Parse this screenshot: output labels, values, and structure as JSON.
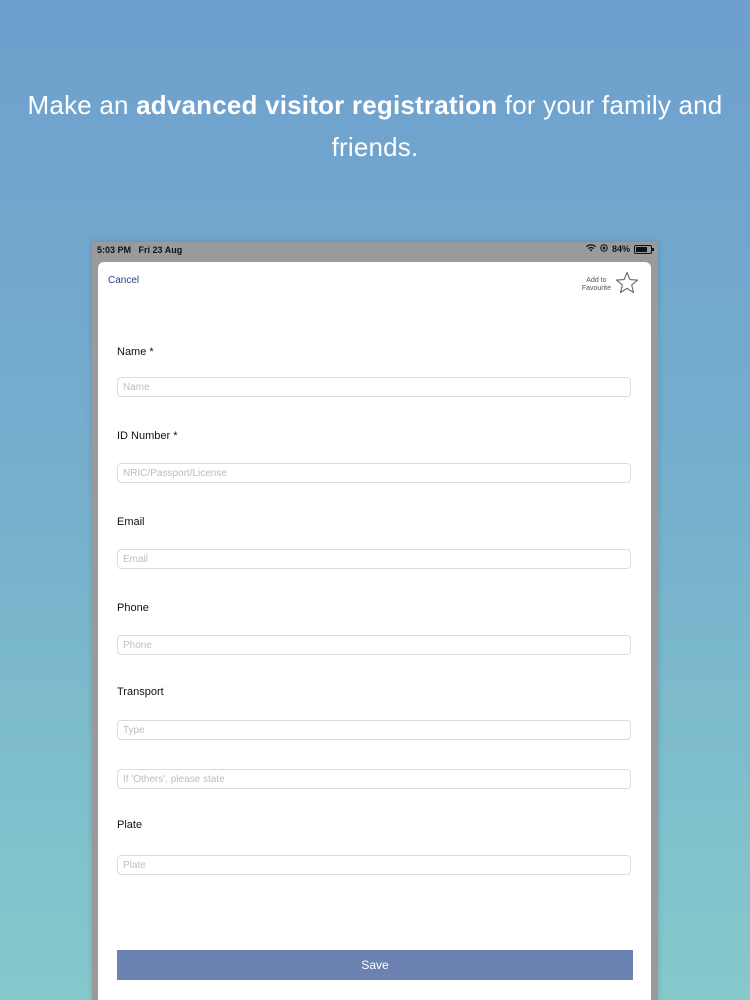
{
  "headline": {
    "prefix": "Make an ",
    "bold": "advanced visitor registration",
    "suffix": " for your family and friends."
  },
  "status_bar": {
    "time": "5:03 PM",
    "date": "Fri 23 Aug",
    "battery": "84%"
  },
  "header": {
    "cancel_label": "Cancel",
    "favourite_label_line1": "Add to",
    "favourite_label_line2": "Favourite"
  },
  "form": {
    "name": {
      "label": "Name *",
      "placeholder": "Name",
      "value": ""
    },
    "id_number": {
      "label": "ID Number *",
      "placeholder": "NRIC/Passport/License",
      "value": ""
    },
    "email": {
      "label": "Email",
      "placeholder": "Email",
      "value": ""
    },
    "phone": {
      "label": "Phone",
      "placeholder": "Phone",
      "value": ""
    },
    "transport": {
      "label": "Transport",
      "type_placeholder": "Type",
      "other_placeholder": "If 'Others', please state"
    },
    "plate": {
      "label": "Plate",
      "placeholder": "Plate",
      "value": ""
    },
    "save_label": "Save"
  },
  "colors": {
    "cancel": "#2a3f8f",
    "save_button": "#6b82b3"
  }
}
